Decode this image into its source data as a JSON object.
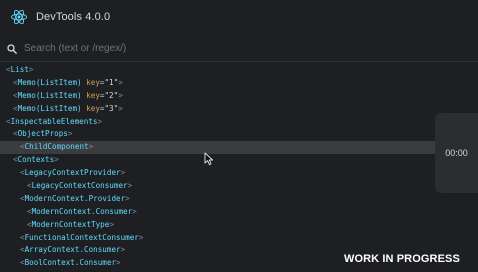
{
  "app": {
    "title": "DevTools 4.0.0",
    "accent_color": "#61dafb"
  },
  "search": {
    "placeholder": "Search (text or /regex/)",
    "value": ""
  },
  "tree": {
    "rows": [
      {
        "depth": 0,
        "tag": "List",
        "selected": false
      },
      {
        "depth": 1,
        "tag": "Memo(ListItem)",
        "key": "\"1\"",
        "selected": false
      },
      {
        "depth": 1,
        "tag": "Memo(ListItem)",
        "key": "\"2\"",
        "selected": false
      },
      {
        "depth": 1,
        "tag": "Memo(ListItem)",
        "key": "\"3\"",
        "selected": false
      },
      {
        "depth": 0,
        "tag": "InspectableElements",
        "selected": false
      },
      {
        "depth": 1,
        "tag": "ObjectProps",
        "selected": false
      },
      {
        "depth": 2,
        "tag": "ChildComponent",
        "selected": true
      },
      {
        "depth": 1,
        "tag": "Contexts",
        "selected": false
      },
      {
        "depth": 2,
        "tag": "LegacyContextProvider",
        "selected": false
      },
      {
        "depth": 3,
        "tag": "LegacyContextConsumer",
        "selected": false
      },
      {
        "depth": 2,
        "tag": "ModernContext.Provider",
        "selected": false
      },
      {
        "depth": 3,
        "tag": "ModernContext.Consumer",
        "selected": false
      },
      {
        "depth": 3,
        "tag": "ModernContextType",
        "selected": false
      },
      {
        "depth": 2,
        "tag": "FunctionalContextConsumer",
        "selected": false
      },
      {
        "depth": 2,
        "tag": "ArrayContext.Consumer",
        "selected": false
      },
      {
        "depth": 2,
        "tag": "BoolContext.Consumer",
        "selected": false
      }
    ],
    "key_attr_label": "key"
  },
  "timer": {
    "text": "00:00"
  },
  "watermark": {
    "text": "WORK IN PROGRESS"
  }
}
